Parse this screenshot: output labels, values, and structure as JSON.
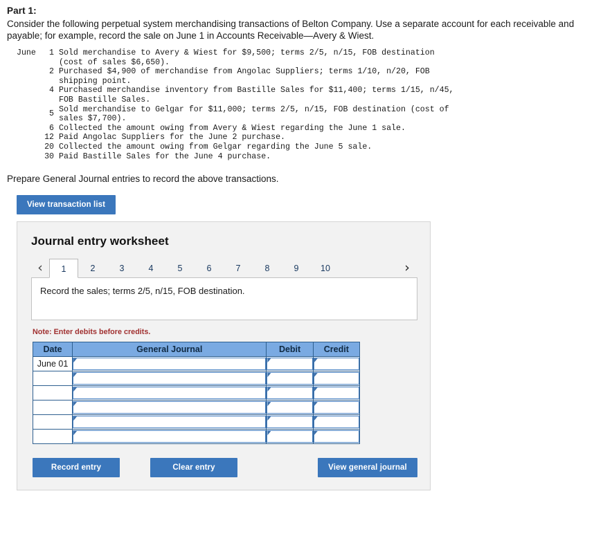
{
  "part": {
    "title": "Part 1:",
    "intro": "Consider the following perpetual system merchandising transactions of Belton Company. Use a separate account for each receivable and payable; for example, record the sale on June 1 in Accounts Receivable—Avery & Wiest."
  },
  "transactions": {
    "month": "June",
    "items": [
      {
        "day": "1",
        "text": "Sold merchandise to Avery & Wiest for $9,500; terms 2/5, n/15, FOB destination (cost of sales $6,650).",
        "centered": false
      },
      {
        "day": "2",
        "text": "Purchased $4,900 of merchandise from Angolac Suppliers; terms 1/10, n/20, FOB shipping point.",
        "centered": false
      },
      {
        "day": "4",
        "text": "Purchased merchandise inventory from Bastille Sales for $11,400; terms 1/15, n/45, FOB Bastille Sales.",
        "centered": false
      },
      {
        "day": "5",
        "text": "Sold merchandise to Gelgar for $11,000; terms 2/5, n/15, FOB destination (cost of sales $7,700).",
        "centered": true
      },
      {
        "day": "6",
        "text": "Collected the amount owing from Avery & Wiest regarding the June 1 sale.",
        "centered": false
      },
      {
        "day": "12",
        "text": "Paid Angolac Suppliers for the June 2 purchase.",
        "centered": false
      },
      {
        "day": "20",
        "text": "Collected the amount owing from Gelgar regarding the June 5 sale.",
        "centered": false
      },
      {
        "day": "30",
        "text": "Paid Bastille Sales for the June 4 purchase.",
        "centered": false
      }
    ]
  },
  "prepare_text": "Prepare General Journal entries to record the above transactions.",
  "view_transaction_list_label": "View transaction list",
  "worksheet": {
    "title": "Journal entry worksheet",
    "prev_arrow": "‹",
    "next_arrow": "›",
    "tabs": [
      {
        "label": "1",
        "active": true
      },
      {
        "label": "2",
        "active": false
      },
      {
        "label": "3",
        "active": false
      },
      {
        "label": "4",
        "active": false
      },
      {
        "label": "5",
        "active": false
      },
      {
        "label": "6",
        "active": false
      },
      {
        "label": "7",
        "active": false
      },
      {
        "label": "8",
        "active": false
      },
      {
        "label": "9",
        "active": false
      },
      {
        "label": "10",
        "active": false
      }
    ],
    "description": "Record the sales; terms 2/5, n/15, FOB destination.",
    "note": "Note: Enter debits before credits.",
    "table": {
      "headers": [
        "Date",
        "General Journal",
        "Debit",
        "Credit"
      ],
      "rows": [
        {
          "date": "June 01",
          "general_journal": "",
          "debit": "",
          "credit": ""
        },
        {
          "date": "",
          "general_journal": "",
          "debit": "",
          "credit": ""
        },
        {
          "date": "",
          "general_journal": "",
          "debit": "",
          "credit": ""
        },
        {
          "date": "",
          "general_journal": "",
          "debit": "",
          "credit": ""
        },
        {
          "date": "",
          "general_journal": "",
          "debit": "",
          "credit": ""
        },
        {
          "date": "",
          "general_journal": "",
          "debit": "",
          "credit": ""
        }
      ]
    },
    "buttons": {
      "record_entry": "Record entry",
      "clear_entry": "Clear entry",
      "view_general_journal": "View general journal"
    }
  },
  "colors": {
    "button_blue": "#3b77bc",
    "table_header_blue": "#7aaae2",
    "note_red": "#a03030",
    "panel_gray": "#f2f2f2"
  }
}
